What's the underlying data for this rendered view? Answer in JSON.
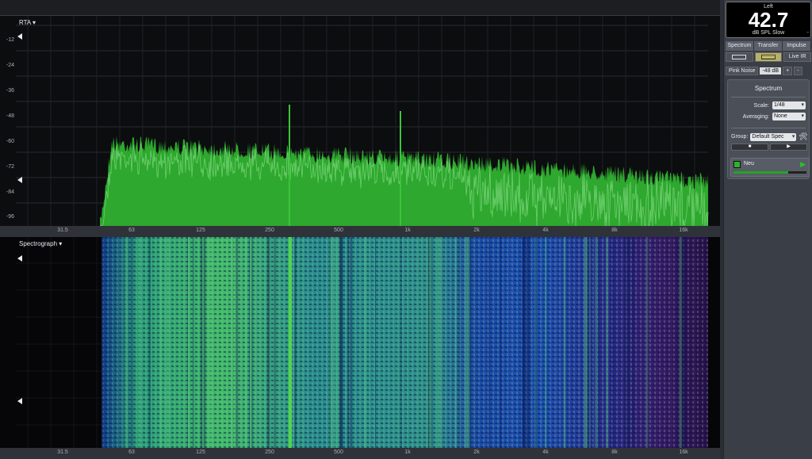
{
  "rta": {
    "label": "RTA ▾",
    "db_ticks": [
      "-12",
      "-24",
      "-36",
      "-48",
      "-60",
      "-72",
      "-84",
      "-96"
    ]
  },
  "spectrograph": {
    "label": "Spectrograph ▾"
  },
  "freq_ticks": [
    "31.5",
    "63",
    "125",
    "250",
    "500",
    "1k",
    "2k",
    "4k",
    "8k",
    "16k"
  ],
  "meter": {
    "channel": "Left",
    "value": "42.7",
    "unit": "dB SPL Slow",
    "minus": "-"
  },
  "tabs": [
    "Spectrum",
    "Transfer",
    "Impulse"
  ],
  "live_ir": "Live IR",
  "generator": {
    "label": "Pink Noise",
    "level": "-48 dB",
    "plus": "+",
    "minus": "-"
  },
  "panel": {
    "title": "Spectrum",
    "scale_label": "Scale:",
    "scale_value": "1/48",
    "avg_label": "Averaging:",
    "avg_value": "None",
    "group_label": "Group:",
    "group_value": "Default Spec",
    "tool_icon": "🛠",
    "stop": "■",
    "play": "▶"
  },
  "measurement": {
    "name": "Neu",
    "play": "▶",
    "level": 0.75,
    "color": "#2bb52b"
  },
  "colors": {
    "rta_green": "#2ea82e",
    "rta_trace": "#7fd97f",
    "background": "#0c0d0f"
  }
}
